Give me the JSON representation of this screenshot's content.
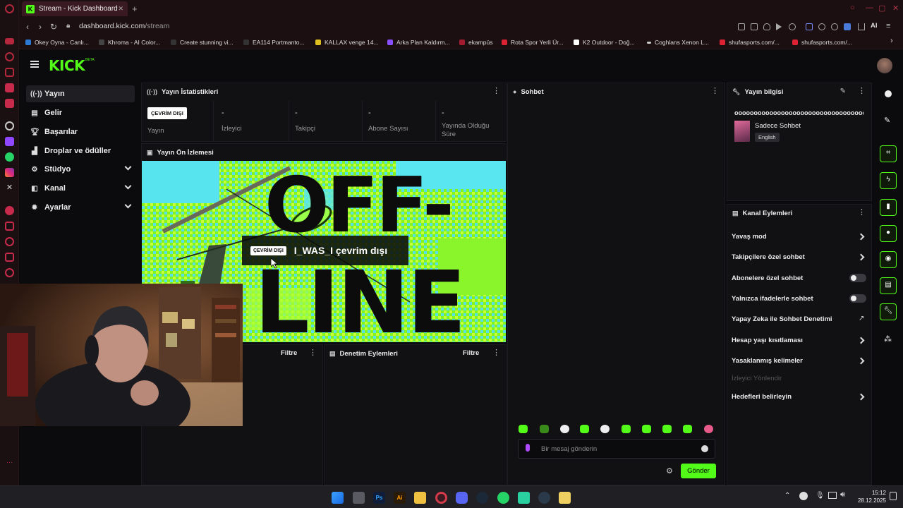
{
  "browser": {
    "tab_title": "Stream - Kick Dashboard",
    "new_tab": "+",
    "url_host": "dashboard.kick.com",
    "url_path": "/stream",
    "ai_label": "AI",
    "bookmarks": [
      "Okey Oyna - Canlı...",
      "Khroma - AI Color...",
      "Create stunning vi...",
      "EA114 Portmanto...",
      "KALLAX venge 14...",
      "Arka Plan Kaldırm...",
      "ekampüs",
      "Rota Spor Yerli Ür...",
      "K2 Outdoor - Doğ...",
      "Coghlans Xenon L...",
      "shufasports.com/...",
      "shufasports.com/..."
    ]
  },
  "kick": {
    "logo": "KICK",
    "beta": "BETA"
  },
  "nav": [
    {
      "label": "Yayın",
      "icon": "broadcast-icon",
      "active": true
    },
    {
      "label": "Gelir",
      "icon": "revenue-icon"
    },
    {
      "label": "Başarılar",
      "icon": "trophy-icon"
    },
    {
      "label": "Droplar ve ödüller",
      "icon": "drops-icon"
    },
    {
      "label": "Stüdyo",
      "icon": "studio-icon",
      "expandable": true
    },
    {
      "label": "Kanal",
      "icon": "channel-icon",
      "expandable": true
    },
    {
      "label": "Ayarlar",
      "icon": "settings-icon",
      "expandable": true
    }
  ],
  "stats": {
    "title": "Yayın İstatistikleri",
    "status_badge": "ÇEVRİM DIŞI",
    "stream_label": "Yayın",
    "items": [
      {
        "value": "-",
        "label": "İzleyici"
      },
      {
        "value": "-",
        "label": "Takipçi"
      },
      {
        "value": "-",
        "label": "Abone Sayısı"
      },
      {
        "value": "-",
        "label": "Yayında Olduğu Süre"
      }
    ]
  },
  "preview": {
    "title": "Yayın Ön İzlemesi",
    "big_text_1": "OFF-",
    "big_text_2": "LINE",
    "overlay_badge": "ÇEVRİM DIŞI",
    "overlay_text": "I_WAS_I çevrim dışı"
  },
  "lower": {
    "filter_1": "Filtre",
    "mod_title": "Denetim Eylemleri",
    "filter_2": "Filtre"
  },
  "chat": {
    "title": "Sohbet",
    "placeholder": "Bir mesaj gönderin",
    "send": "Gönder"
  },
  "stream_info": {
    "title": "Yayın bilgisi",
    "stream_title": "oooooooooooooooooooooooooooooooooooooooo",
    "category": "Sadece Sohbet",
    "language": "English"
  },
  "channel_actions": {
    "title": "Kanal Eylemleri",
    "items": [
      {
        "label": "Yavaş mod",
        "kind": "chevron"
      },
      {
        "label": "Takipçilere özel sohbet",
        "kind": "chevron"
      },
      {
        "label": "Abonelere özel sohbet",
        "kind": "toggle"
      },
      {
        "label": "Yalnızca ifadelerle sohbet",
        "kind": "toggle"
      },
      {
        "label": "Yapay Zeka ile Sohbet Denetimi",
        "kind": "external"
      },
      {
        "label": "Hesap yaşı kısıtlaması",
        "kind": "chevron"
      },
      {
        "label": "Yasaklanmış kelimeler",
        "kind": "chevron"
      },
      {
        "label": "İzleyici Yönlendir",
        "kind": "disabled"
      },
      {
        "label": "Hedefleri belirleyin",
        "kind": "chevron"
      }
    ]
  },
  "taskbar": {
    "time": "15:12",
    "date": "28.12.2025"
  },
  "colors": {
    "accent": "#53fc18",
    "bg": "#0b0b0d",
    "panel": "#111114"
  }
}
